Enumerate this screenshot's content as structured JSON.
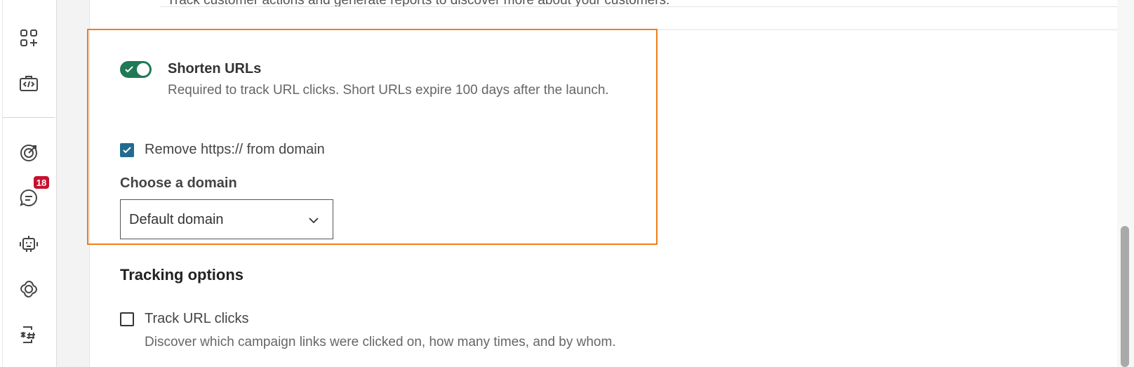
{
  "sidebar": {
    "items": [
      {
        "icon": "apps-add-icon"
      },
      {
        "icon": "code-briefcase-icon"
      },
      {
        "icon": "target-icon"
      },
      {
        "icon": "chat-icon",
        "badge": "18"
      },
      {
        "icon": "robot-icon"
      },
      {
        "icon": "openai-icon"
      },
      {
        "icon": "hash-phone-icon"
      }
    ]
  },
  "top_text": "Track customer actions and generate reports to discover more about your customers.",
  "shorten": {
    "toggle_on": true,
    "title": "Shorten URLs",
    "description": "Required to track URL clicks. Short URLs expire 100 days after the launch.",
    "remove_https_checked": true,
    "remove_https_label": "Remove https:// from domain",
    "domain_label": "Choose a domain",
    "domain_value": "Default domain"
  },
  "tracking": {
    "title": "Tracking options",
    "track_clicks_checked": false,
    "track_clicks_label": "Track URL clicks",
    "track_clicks_description": "Discover which campaign links were clicked on, how many times, and by whom."
  },
  "colors": {
    "toggle_on": "#1f7a55",
    "checkbox_checked": "#236b8e",
    "highlight_border": "#f07d1a",
    "badge": "#c8102e"
  }
}
